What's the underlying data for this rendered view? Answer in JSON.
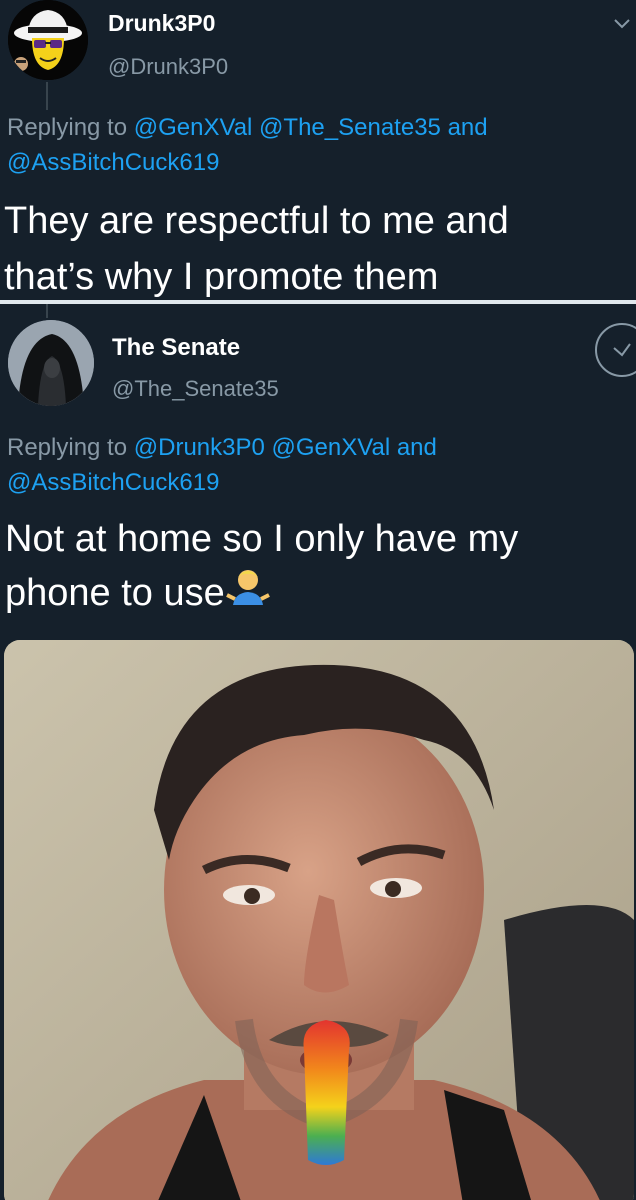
{
  "tweet1": {
    "display_name": "Drunk3P0",
    "handle": "@Drunk3P0",
    "reply_prefix": "Replying to",
    "reply_mentions_line1": "@GenXVal @The_Senate35",
    "reply_and": "and",
    "reply_mentions_line2": "@AssBitchCuck619",
    "text_line1": "They are respectful to me and",
    "text_line2": "that’s why I promote them",
    "avatar_icon": "cartoon-skull-avatar",
    "menu_icon": "chevron-down-icon"
  },
  "tweet2": {
    "display_name": "The Senate",
    "handle": "@The_Senate35",
    "reply_prefix": "Replying to",
    "reply_mentions_line1": "@Drunk3P0 @GenXVal",
    "reply_and": "and",
    "reply_mentions_line2": "@AssBitchCuck619",
    "text_line1": "Not at home so I only have my",
    "text_line2": "phone to use",
    "emoji": "man-shrugging-emoji",
    "avatar_icon": "hooded-figure-avatar",
    "action_icon": "follow-circle-icon",
    "media": "photo"
  },
  "colors": {
    "background": "#15202b",
    "text": "#ffffff",
    "secondary": "#8899a6",
    "link": "#1da1f2",
    "divider": "#e1e8ed"
  }
}
